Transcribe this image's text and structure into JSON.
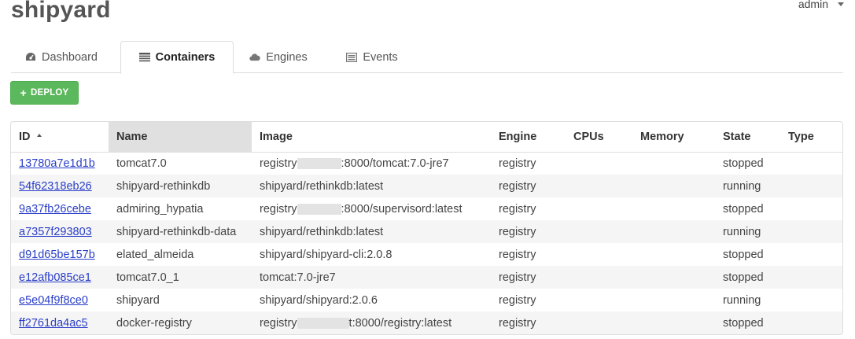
{
  "app": {
    "brand": "shipyard"
  },
  "user": {
    "name": "admin"
  },
  "tabs": [
    {
      "label": "Dashboard",
      "icon": "dashboard-icon",
      "active": false
    },
    {
      "label": "Containers",
      "icon": "list-icon",
      "active": true
    },
    {
      "label": "Engines",
      "icon": "cloud-icon",
      "active": false
    },
    {
      "label": "Events",
      "icon": "events-icon",
      "active": false
    }
  ],
  "toolbar": {
    "deploy_label": "DEPLOY",
    "deploy_icon": "plus-icon",
    "deploy_color": "#5cb85c"
  },
  "table": {
    "columns": [
      "ID",
      "Name",
      "Image",
      "Engine",
      "CPUs",
      "Memory",
      "State",
      "Type"
    ],
    "sorted_column": "ID",
    "rows": [
      {
        "id": "13780a7e1d1b",
        "name": "tomcat7.0",
        "image_prefix": "registry",
        "image_suffix": ":8000/tomcat:7.0-jre7",
        "image": "",
        "engine": "registry",
        "cpus": "",
        "memory": "",
        "state": "stopped",
        "type": ""
      },
      {
        "id": "54f62318eb26",
        "name": "shipyard-rethinkdb",
        "image_prefix": "",
        "image_suffix": "",
        "image": "shipyard/rethinkdb:latest",
        "engine": "registry",
        "cpus": "",
        "memory": "",
        "state": "running",
        "type": ""
      },
      {
        "id": "9a37fb26cebe",
        "name": "admiring_hypatia",
        "image_prefix": "registry",
        "image_suffix": ":8000/supervisord:latest",
        "image": "",
        "engine": "registry",
        "cpus": "",
        "memory": "",
        "state": "stopped",
        "type": ""
      },
      {
        "id": "a7357f293803",
        "name": "shipyard-rethinkdb-data",
        "image_prefix": "",
        "image_suffix": "",
        "image": "shipyard/rethinkdb:latest",
        "engine": "registry",
        "cpus": "",
        "memory": "",
        "state": "running",
        "type": ""
      },
      {
        "id": "d91d65be157b",
        "name": "elated_almeida",
        "image_prefix": "",
        "image_suffix": "",
        "image": "shipyard/shipyard-cli:2.0.8",
        "engine": "registry",
        "cpus": "",
        "memory": "",
        "state": "stopped",
        "type": ""
      },
      {
        "id": "e12afb085ce1",
        "name": "tomcat7.0_1",
        "image_prefix": "",
        "image_suffix": "",
        "image": "tomcat:7.0-jre7",
        "engine": "registry",
        "cpus": "",
        "memory": "",
        "state": "stopped",
        "type": ""
      },
      {
        "id": "e5e04f9f8ce0",
        "name": "shipyard",
        "image_prefix": "",
        "image_suffix": "",
        "image": "shipyard/shipyard:2.0.6",
        "engine": "registry",
        "cpus": "",
        "memory": "",
        "state": "running",
        "type": ""
      },
      {
        "id": "ff2761da4ac5",
        "name": "docker-registry",
        "image_prefix": "registry",
        "image_suffix": "t:8000/registry:latest",
        "image": "",
        "engine": "registry",
        "cpus": "",
        "memory": "",
        "state": "stopped",
        "type": ""
      }
    ]
  }
}
